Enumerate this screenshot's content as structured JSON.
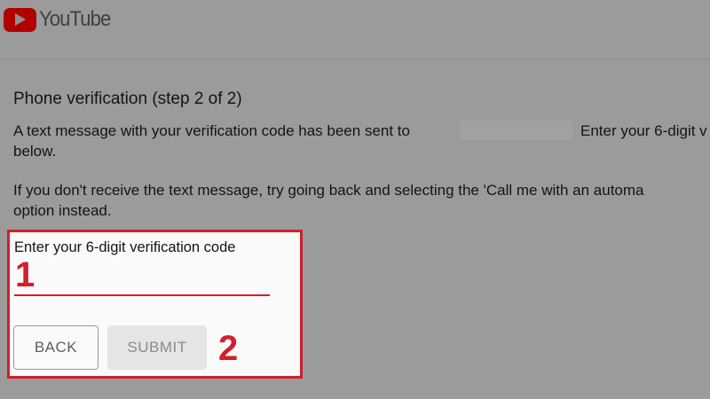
{
  "header": {
    "logo_text": "YouTube"
  },
  "verification": {
    "heading": "Phone verification (step 2 of 2)",
    "message_line1_before": "A text message with your verification code has been sent to",
    "message_line1_after": "Enter your 6-digit v",
    "message_line2": "below.",
    "fallback_line1": "If you don't receive the text message, try going back and selecting the 'Call me with an automa",
    "fallback_line2": "option instead."
  },
  "form": {
    "field_label": "Enter your 6-digit verification code",
    "code_value": "",
    "back_label": "BACK",
    "submit_label": "SUBMIT"
  },
  "annotations": {
    "step1": "1",
    "step2": "2",
    "highlight_color": "#d21f2b"
  },
  "colors": {
    "brand_red": "#b00000",
    "overlay_gray": "#9b9b9b"
  }
}
